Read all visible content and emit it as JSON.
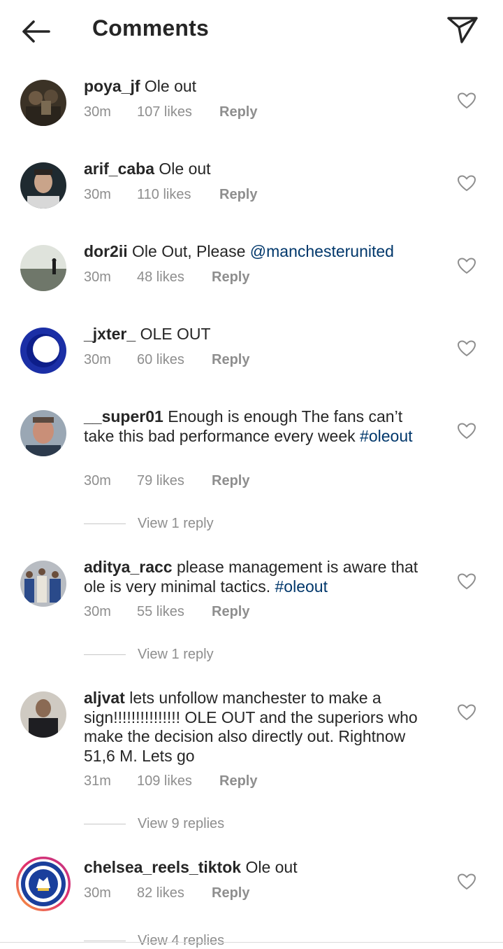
{
  "header": {
    "title": "Comments",
    "back_icon": "arrow-left-icon",
    "send_icon": "paper-plane-icon"
  },
  "colors": {
    "text": "#262626",
    "secondary": "#8e8e8e",
    "link": "#00376b"
  },
  "comments": [
    {
      "username": "poya_jf",
      "text": "Ole out",
      "time": "30m",
      "likes": "107 likes",
      "reply": "Reply"
    },
    {
      "username": "arif_caba",
      "text": "Ole out",
      "time": "30m",
      "likes": "110 likes",
      "reply": "Reply"
    },
    {
      "username": "dor2ii",
      "text": "Ole Out, Please",
      "mention": "@manchesterunited",
      "time": "30m",
      "likes": "48 likes",
      "reply": "Reply"
    },
    {
      "username": "_jxter_",
      "text": "OLE OUT",
      "time": "30m",
      "likes": "60 likes",
      "reply": "Reply"
    },
    {
      "username": "__super01",
      "text": "Enough is enough The fans can’t take this bad performance every week",
      "hashtag": "#oleout",
      "time": "30m",
      "likes": "79 likes",
      "reply": "Reply",
      "view_replies": "View 1 reply"
    },
    {
      "username": "aditya_racc",
      "text": "please management is aware that ole is very minimal tactics.",
      "hashtag": "#oleout",
      "time": "30m",
      "likes": "55 likes",
      "reply": "Reply",
      "view_replies": "View 1 reply"
    },
    {
      "username": "aljvat",
      "text": "lets unfollow manchester to make a sign!!!!!!!!!!!!!!! OLE OUT and the superiors who make the decision also directly out. Rightnow 51,6 M. Lets go",
      "time": "31m",
      "likes": "109 likes",
      "reply": "Reply",
      "view_replies": "View 9 replies"
    },
    {
      "username": "chelsea_reels_tiktok",
      "text": "Ole out",
      "time": "30m",
      "likes": "82 likes",
      "reply": "Reply",
      "view_replies": "View 4 replies"
    }
  ]
}
